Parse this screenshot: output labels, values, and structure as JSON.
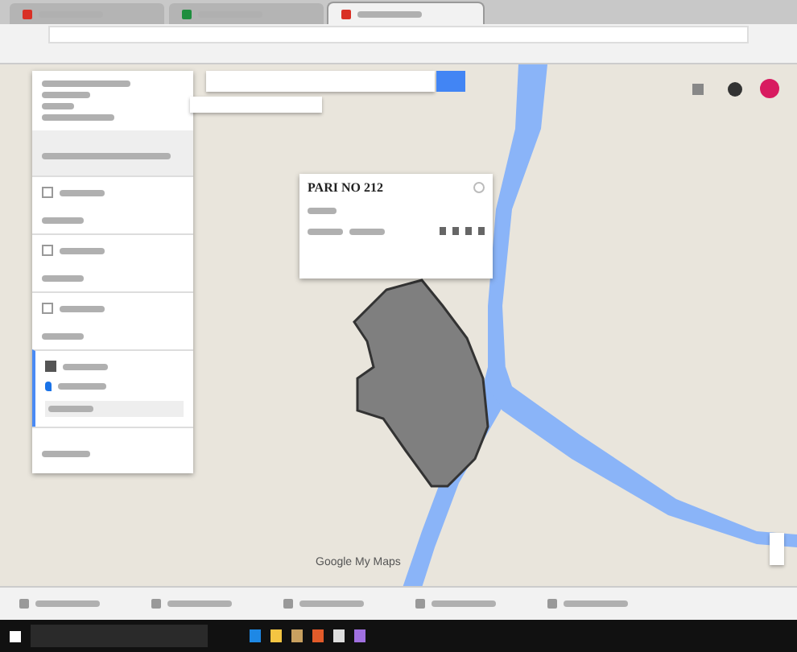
{
  "browser": {
    "tabs": [
      {
        "selected": false,
        "color": "#d93025"
      },
      {
        "selected": false,
        "color": "#1e8e3e"
      },
      {
        "selected": true,
        "color": "#d93025"
      }
    ]
  },
  "sidebar": {
    "layers": [
      {
        "checked": false,
        "kind": "layer"
      },
      {
        "checked": false,
        "kind": "layer"
      },
      {
        "checked": false,
        "kind": "layer"
      },
      {
        "checked": true,
        "kind": "active"
      }
    ]
  },
  "map": {
    "popup": {
      "title": "PARI NO 212"
    },
    "logo": "Google My Maps"
  },
  "downloads": [
    {
      "kind": "file"
    },
    {
      "kind": "file"
    },
    {
      "kind": "file"
    },
    {
      "kind": "file"
    },
    {
      "kind": "file"
    }
  ]
}
